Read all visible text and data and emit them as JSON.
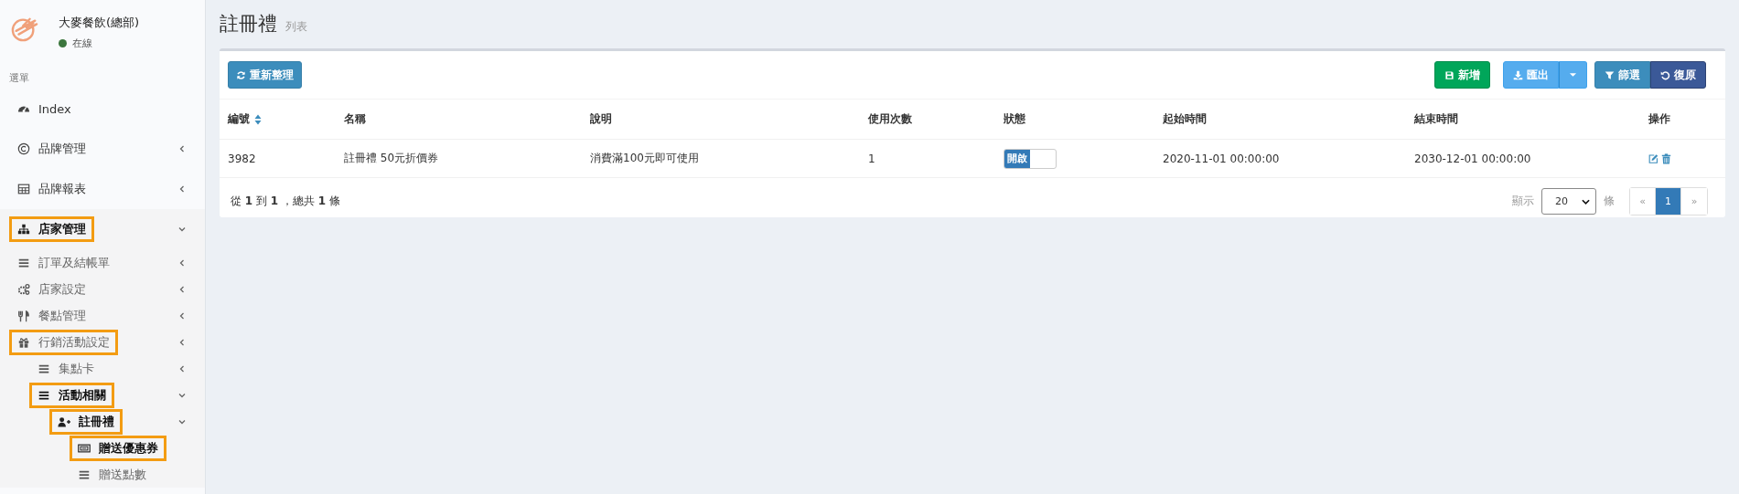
{
  "brand": {
    "name": "大麥餐飲(總部)",
    "status": "在線",
    "online": true
  },
  "sidebar": {
    "header": "選單",
    "items": [
      {
        "label": "Index",
        "active": false,
        "highlighted": false
      },
      {
        "label": "品牌管理",
        "active": false,
        "highlighted": false,
        "expanded": false
      },
      {
        "label": "品牌報表",
        "active": false,
        "highlighted": false,
        "expanded": false
      },
      {
        "label": "店家管理",
        "active": true,
        "highlighted": true,
        "expanded": true,
        "children": [
          {
            "label": "訂單及結帳單",
            "active": false,
            "highlighted": false,
            "expanded": false
          },
          {
            "label": "店家設定",
            "active": false,
            "highlighted": false,
            "expanded": false
          },
          {
            "label": "餐點管理",
            "active": false,
            "highlighted": false,
            "expanded": false
          },
          {
            "label": "行銷活動設定",
            "active": false,
            "highlighted": true,
            "expanded": false,
            "children": [
              {
                "label": "集點卡",
                "active": false,
                "highlighted": false,
                "expanded": false
              },
              {
                "label": "活動相關",
                "active": true,
                "highlighted": true,
                "expanded": true,
                "children": [
                  {
                    "label": "註冊禮",
                    "active": true,
                    "highlighted": true,
                    "expanded": true,
                    "children": [
                      {
                        "label": "贈送優惠券",
                        "active": true,
                        "highlighted": true
                      },
                      {
                        "label": "贈送點數",
                        "active": false,
                        "highlighted": false
                      }
                    ]
                  }
                ]
              }
            ]
          }
        ]
      }
    ]
  },
  "page": {
    "title": "註冊禮",
    "subtitle": "列表"
  },
  "toolbar": {
    "refresh": "重新整理",
    "add": "新增",
    "export": "匯出",
    "filter": "篩選",
    "reset": "復原"
  },
  "table": {
    "columns": [
      {
        "label": "編號",
        "sortable": true
      },
      {
        "label": "名稱",
        "sortable": false
      },
      {
        "label": "說明",
        "sortable": false
      },
      {
        "label": "使用次數",
        "sortable": false
      },
      {
        "label": "狀態",
        "sortable": false
      },
      {
        "label": "起始時間",
        "sortable": false
      },
      {
        "label": "結束時間",
        "sortable": false
      },
      {
        "label": "操作",
        "sortable": false
      }
    ],
    "rows": [
      {
        "id": "3982",
        "name": "註冊禮 50元折價券",
        "description": "消費滿100元即可使用",
        "uses": "1",
        "status": {
          "on": true,
          "label": "開啟"
        },
        "start": "2020-11-01 00:00:00",
        "end": "2030-12-01 00:00:00"
      }
    ]
  },
  "footer": {
    "summary": "從 **1** 到 **1** ，總共 **1** 條",
    "show_label": "顯示",
    "page_size": "20",
    "unit": "條",
    "pages": [
      {
        "label": "«",
        "selected": false
      },
      {
        "label": "1",
        "selected": true
      },
      {
        "label": "»",
        "selected": false
      }
    ]
  }
}
